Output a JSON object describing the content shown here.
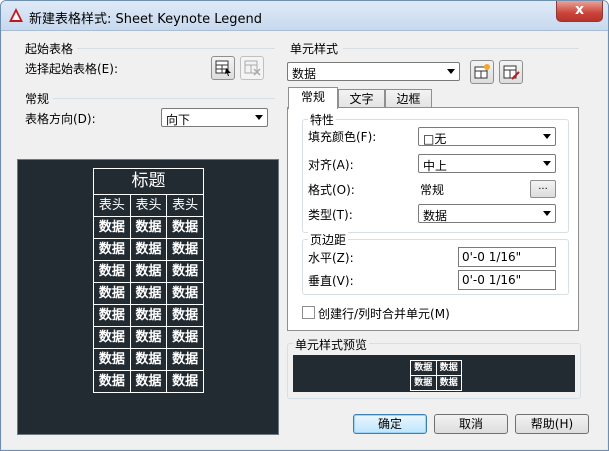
{
  "title": "新建表格样式: Sheet Keynote Legend",
  "close_glyph": "x",
  "left": {
    "start_table_group": "起始表格",
    "select_start_label": "选择起始表格(E):",
    "general_group": "常规",
    "direction_label": "表格方向(D):",
    "direction_value": "向下"
  },
  "preview": {
    "title": "标题",
    "header_row": [
      "表头",
      "表头",
      "表头"
    ],
    "data_cell": "数据",
    "data_rows": 8
  },
  "right": {
    "cell_style_group": "单元样式",
    "cell_style_value": "数据",
    "tabs": [
      "常规",
      "文字",
      "边框"
    ],
    "properties_group": "特性",
    "fill_color_label": "填充颜色(F):",
    "fill_color_value": "□无",
    "align_label": "对齐(A):",
    "align_value": "中上",
    "format_label": "格式(O):",
    "format_value": "常规",
    "format_button": "...",
    "type_label": "类型(T):",
    "type_value": "数据",
    "margins_group": "页边距",
    "horizontal_label": "水平(Z):",
    "horizontal_value": "0'-0 1/16\"",
    "vertical_label": "垂直(V):",
    "vertical_value": "0'-0 1/16\"",
    "merge_label": "创建行/列时合并单元(M)",
    "cell_preview_group": "单元样式预览",
    "cell_preview_text": "数据"
  },
  "buttons": {
    "ok": "确定",
    "cancel": "取消",
    "help": "帮助(H)"
  }
}
